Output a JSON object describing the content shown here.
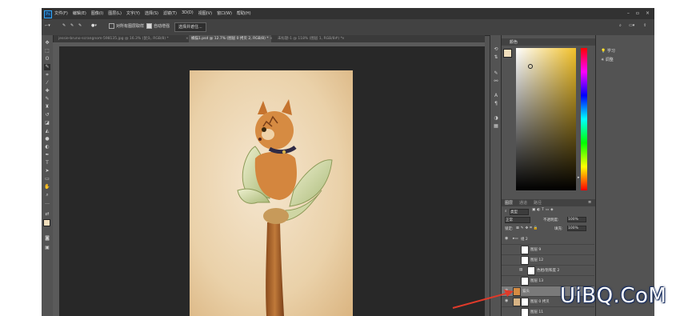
{
  "app": {
    "logo": "Ps",
    "menus": [
      "文件(F)",
      "编辑(E)",
      "图像(I)",
      "图层(L)",
      "文字(Y)",
      "选择(S)",
      "滤镜(T)",
      "3D(D)",
      "视图(V)",
      "窗口(W)",
      "帮助(H)"
    ]
  },
  "options": {
    "sample_all_layers": "对所有图层取样",
    "auto_enhance": "自动增强",
    "select_and_mask": "选择并遮住..."
  },
  "tabs": [
    {
      "label": "jessie-bruno-scrangnom-598135.jpg @ 16.3% (鼠头, RGB/8) *"
    },
    {
      "label": "橘猫1.psd @ 12.7% (图层 0 拷贝 2, RGB/8) *"
    },
    {
      "label": "未标题-1 @ 118% (图层 1, RGB/8#) *"
    }
  ],
  "color_panel": {
    "tab": "颜色"
  },
  "side_panel": {
    "learn": "学习",
    "adjust": "调整"
  },
  "layers_panel": {
    "tabs": [
      "图层",
      "通道",
      "路径"
    ],
    "kind_filter": "类型",
    "blend_mode": "正常",
    "opacity_label": "不透明度:",
    "opacity_value": "100%",
    "lock_label": "锁定:",
    "fill_label": "填充:",
    "fill_value": "100%",
    "layers": [
      {
        "name": "组 2"
      },
      {
        "name": "图层 9"
      },
      {
        "name": "图层 12"
      },
      {
        "name": "色相/饱和度 2"
      },
      {
        "name": "图层 13"
      },
      {
        "name": "猫头"
      },
      {
        "name": "图层 0 拷贝"
      },
      {
        "name": "图层 11"
      }
    ]
  },
  "watermark": "UiBQ.CoM",
  "colors": {
    "arrow": "#e03a2a",
    "foreground": "#f1dfbd",
    "watermark_outline": "#1a2f60"
  }
}
